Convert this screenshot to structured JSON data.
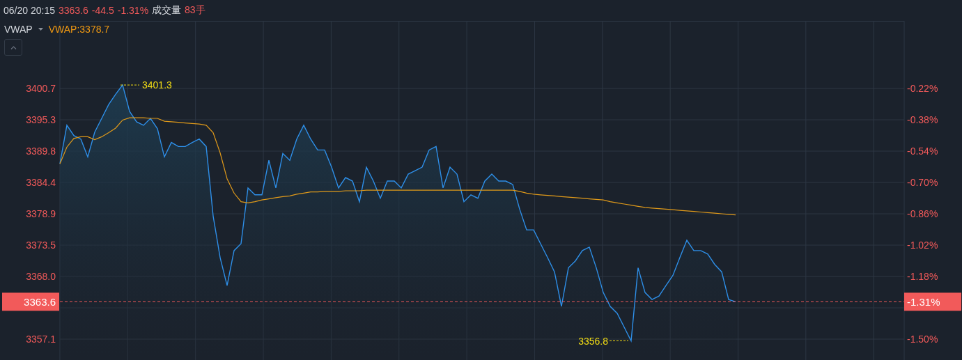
{
  "header": {
    "datetime": "06/20 20:15",
    "price": "3363.6",
    "change": "-44.5",
    "change_percent": "-1.31%",
    "volume_label": "成交量",
    "volume": "83手"
  },
  "legend": {
    "value": "VWAP:3378.7"
  },
  "chart": {
    "chart_data": {
      "type": "area",
      "grid": true,
      "ylim": [
        3353.47,
        3412.45
      ],
      "yticks": [
        {
          "value": 3400.7,
          "label": "3400.7"
        },
        {
          "value": 3395.3,
          "label": "3395.3"
        },
        {
          "value": 3389.8,
          "label": "3389.8"
        },
        {
          "value": 3384.4,
          "label": "3384.4"
        },
        {
          "value": 3378.9,
          "label": "3378.9"
        },
        {
          "value": 3373.5,
          "label": "3373.5"
        },
        {
          "value": 3368.0,
          "label": "3368.0"
        },
        {
          "value": 3357.1,
          "label": "3357.1"
        }
      ],
      "series": [
        {
          "color": "#2e8fe8",
          "values": [
            3387.6,
            3394.3,
            3392.5,
            3391.9,
            3388.8,
            3393.1,
            3395.5,
            3397.9,
            3399.7,
            3401.3,
            3396.7,
            3394.9,
            3394.3,
            3395.5,
            3393.7,
            3388.8,
            3391.3,
            3390.6,
            3390.6,
            3391.3,
            3391.9,
            3390.6,
            3378.5,
            3371.3,
            3366.4,
            3372.5,
            3373.7,
            3383.4,
            3382.2,
            3382.2,
            3388.2,
            3383.4,
            3389.4,
            3388.2,
            3391.9,
            3394.3,
            3391.9,
            3390.0,
            3390.0,
            3387.0,
            3383.4,
            3385.2,
            3384.6,
            3381.0,
            3387.0,
            3384.6,
            3381.6,
            3384.6,
            3384.6,
            3383.4,
            3385.8,
            3386.4,
            3387.0,
            3390.0,
            3390.6,
            3383.4,
            3387.0,
            3385.8,
            3381.0,
            3382.2,
            3381.6,
            3384.6,
            3385.8,
            3384.6,
            3384.6,
            3384.0,
            3379.7,
            3376.1,
            3376.1,
            3373.7,
            3371.3,
            3368.8,
            3362.8,
            3369.5,
            3370.7,
            3372.5,
            3373.1,
            3369.5,
            3365.2,
            3362.8,
            3361.6,
            3359.2,
            3356.8,
            3369.5,
            3365.2,
            3364.0,
            3364.6,
            3366.4,
            3368.2,
            3371.3,
            3374.3,
            3372.5,
            3372.5,
            3371.9,
            3370.1,
            3368.8,
            3364.0,
            3363.6
          ]
        },
        {
          "name": "VWAP",
          "type": "line",
          "color": "#e09a1a",
          "values": [
            3387.6,
            3390.5,
            3392.0,
            3392.3,
            3392.3,
            3391.8,
            3392.3,
            3393.0,
            3393.8,
            3395.2,
            3395.6,
            3395.6,
            3395.6,
            3395.5,
            3395.5,
            3395.0,
            3394.9,
            3394.8,
            3394.7,
            3394.6,
            3394.5,
            3394.3,
            3393.0,
            3389.5,
            3385.0,
            3382.5,
            3381.0,
            3380.8,
            3381.0,
            3381.3,
            3381.5,
            3381.7,
            3381.9,
            3382.0,
            3382.3,
            3382.5,
            3382.7,
            3382.7,
            3382.8,
            3382.8,
            3382.8,
            3382.9,
            3382.9,
            3382.9,
            3383.0,
            3383.0,
            3383.0,
            3383.0,
            3383.0,
            3383.0,
            3383.0,
            3383.0,
            3383.0,
            3383.0,
            3383.0,
            3383.0,
            3383.0,
            3383.0,
            3383.0,
            3383.0,
            3383.0,
            3383.0,
            3383.0,
            3383.0,
            3383.0,
            3383.0,
            3382.8,
            3382.5,
            3382.3,
            3382.2,
            3382.1,
            3382.0,
            3381.9,
            3381.8,
            3381.7,
            3381.6,
            3381.5,
            3381.4,
            3381.3,
            3381.0,
            3380.8,
            3380.6,
            3380.4,
            3380.2,
            3380.0,
            3379.9,
            3379.8,
            3379.7,
            3379.6,
            3379.5,
            3379.4,
            3379.3,
            3379.2,
            3379.1,
            3379.0,
            3378.9,
            3378.8,
            3378.7
          ]
        }
      ],
      "annotations": [
        "3401.3",
        "3356.8"
      ],
      "ref_lines": [
        {
          "axis": "y",
          "value": 3363.6,
          "label": "3363.6",
          "color": "#f25a5a"
        }
      ]
    },
    "last_percent_tag": "-1.31%",
    "right_axis_labels": [
      "-0.22%",
      "-0.38%",
      "-0.54%",
      "-0.70%",
      "-0.86%",
      "-1.02%",
      "-1.18%",
      "-1.50%"
    ]
  }
}
